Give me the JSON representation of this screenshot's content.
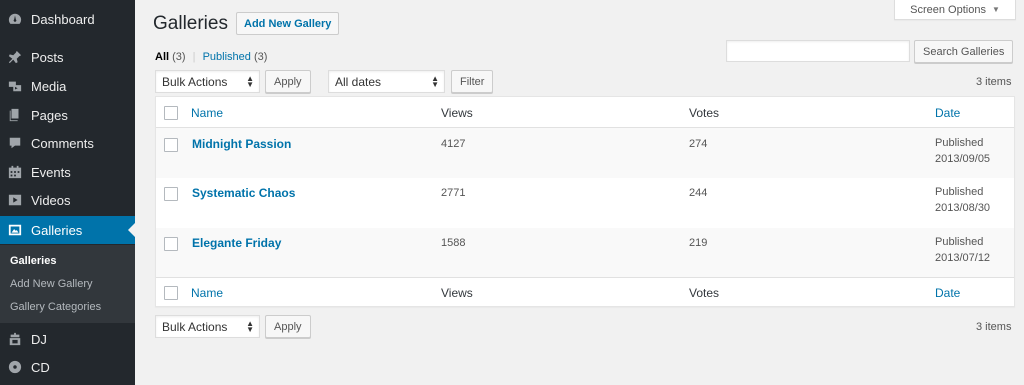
{
  "sidebar": {
    "items": [
      {
        "label": "Dashboard",
        "icon": "dashboard-icon"
      },
      {
        "label": "Posts",
        "icon": "pin-icon"
      },
      {
        "label": "Media",
        "icon": "media-icon"
      },
      {
        "label": "Pages",
        "icon": "pages-icon"
      },
      {
        "label": "Comments",
        "icon": "comment-icon"
      },
      {
        "label": "Events",
        "icon": "calendar-icon"
      },
      {
        "label": "Videos",
        "icon": "video-icon"
      },
      {
        "label": "Galleries",
        "icon": "gallery-icon",
        "active": true
      },
      {
        "label": "DJ",
        "icon": "dj-icon"
      },
      {
        "label": "CD",
        "icon": "cd-icon"
      }
    ],
    "submenu": [
      "Galleries",
      "Add New Gallery",
      "Gallery Categories"
    ],
    "active_color": "#0073aa"
  },
  "header": {
    "title": "Galleries",
    "add_new_label": "Add New Gallery",
    "screen_options_label": "Screen Options"
  },
  "views": {
    "all_label": "All",
    "all_count": "(3)",
    "sep": "|",
    "published_label": "Published",
    "published_count": "(3)"
  },
  "search": {
    "value": "",
    "button_label": "Search Galleries"
  },
  "toolbar": {
    "bulk_actions": "Bulk Actions",
    "apply_label": "Apply",
    "dates_filter": "All dates",
    "filter_label": "Filter",
    "items_count": "3 items"
  },
  "table": {
    "columns": [
      "Name",
      "Views",
      "Votes",
      "Date"
    ],
    "rows": [
      {
        "name": "Midnight Passion",
        "views": "4127",
        "votes": "274",
        "status": "Published",
        "date": "2013/09/05"
      },
      {
        "name": "Systematic Chaos",
        "views": "2771",
        "votes": "244",
        "status": "Published",
        "date": "2013/08/30"
      },
      {
        "name": "Elegante Friday",
        "views": "1588",
        "votes": "219",
        "status": "Published",
        "date": "2013/07/12"
      }
    ]
  },
  "bottom_toolbar": {
    "bulk_actions": "Bulk Actions",
    "apply_label": "Apply",
    "items_count": "3 items"
  }
}
